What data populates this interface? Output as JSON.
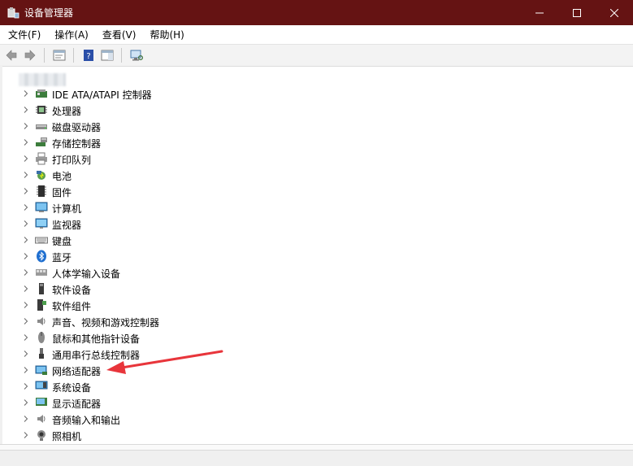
{
  "window": {
    "title": "设备管理器",
    "colors": {
      "titlebar": "#651313",
      "annotation_arrow": "#e8353b"
    }
  },
  "menubar": {
    "items": [
      {
        "label": "文件(F)"
      },
      {
        "label": "操作(A)"
      },
      {
        "label": "查看(V)"
      },
      {
        "label": "帮助(H)"
      }
    ]
  },
  "toolbar": {
    "icons": [
      "back-arrow-icon",
      "forward-arrow-icon",
      "properties-icon",
      "help-icon",
      "action-pane-icon",
      "scan-hardware-icon"
    ]
  },
  "tree": {
    "items": [
      {
        "label": "IDE ATA/ATAPI 控制器",
        "icon": "ide-controller-icon"
      },
      {
        "label": "处理器",
        "icon": "processor-icon"
      },
      {
        "label": "磁盘驱动器",
        "icon": "disk-drive-icon"
      },
      {
        "label": "存储控制器",
        "icon": "storage-controller-icon"
      },
      {
        "label": "打印队列",
        "icon": "printer-icon"
      },
      {
        "label": "电池",
        "icon": "battery-icon"
      },
      {
        "label": "固件",
        "icon": "firmware-icon"
      },
      {
        "label": "计算机",
        "icon": "computer-icon"
      },
      {
        "label": "监视器",
        "icon": "monitor-icon"
      },
      {
        "label": "键盘",
        "icon": "keyboard-icon"
      },
      {
        "label": "蓝牙",
        "icon": "bluetooth-icon"
      },
      {
        "label": "人体学输入设备",
        "icon": "hid-icon"
      },
      {
        "label": "软件设备",
        "icon": "software-device-icon"
      },
      {
        "label": "软件组件",
        "icon": "software-component-icon"
      },
      {
        "label": "声音、视频和游戏控制器",
        "icon": "speaker-icon"
      },
      {
        "label": "鼠标和其他指针设备",
        "icon": "mouse-icon"
      },
      {
        "label": "通用串行总线控制器",
        "icon": "usb-icon"
      },
      {
        "label": "网络适配器",
        "icon": "network-adapter-icon"
      },
      {
        "label": "系统设备",
        "icon": "system-device-icon"
      },
      {
        "label": "显示适配器",
        "icon": "display-adapter-icon"
      },
      {
        "label": "音频输入和输出",
        "icon": "audio-io-icon"
      },
      {
        "label": "照相机",
        "icon": "camera-icon"
      }
    ]
  }
}
